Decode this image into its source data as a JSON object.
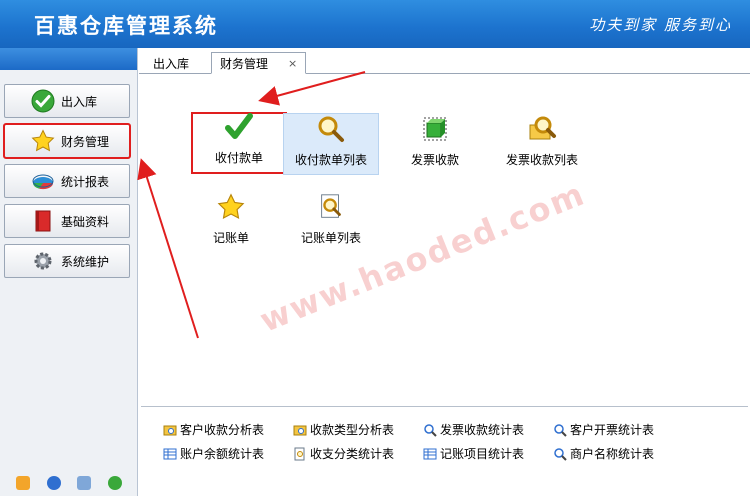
{
  "header": {
    "title": "百惠仓库管理系统",
    "slogan": "功夫到家 服务到心"
  },
  "sidebar": {
    "items": [
      {
        "label": "出入库",
        "icon": "check-circle-icon"
      },
      {
        "label": "财务管理",
        "icon": "star-icon"
      },
      {
        "label": "统计报表",
        "icon": "pie-chart-icon"
      },
      {
        "label": "基础资料",
        "icon": "book-icon"
      },
      {
        "label": "系统维护",
        "icon": "gear-icon"
      }
    ]
  },
  "tabs": [
    {
      "label": "出入库"
    },
    {
      "label": "财务管理",
      "close": "×"
    }
  ],
  "tiles": [
    {
      "label": "收付款单",
      "icon": "checkmark-icon"
    },
    {
      "label": "收付款单列表",
      "icon": "magnifier-icon"
    },
    {
      "label": "发票收款",
      "icon": "green-box-icon"
    },
    {
      "label": "发票收款列表",
      "icon": "magnifier-box-icon"
    },
    {
      "label": "记账单",
      "icon": "star-icon"
    },
    {
      "label": "记账单列表",
      "icon": "document-search-icon"
    }
  ],
  "watermark": "www.haoded.com",
  "reports": [
    {
      "label": "客户收款分析表",
      "icon": "folder-search-icon"
    },
    {
      "label": "收款类型分析表",
      "icon": "folder-search-icon"
    },
    {
      "label": "发票收款统计表",
      "icon": "magnifier-icon"
    },
    {
      "label": "客户开票统计表",
      "icon": "magnifier-icon"
    },
    {
      "label": "账户余额统计表",
      "icon": "table-icon"
    },
    {
      "label": "收支分类统计表",
      "icon": "magnifier-doc-icon"
    },
    {
      "label": "记账项目统计表",
      "icon": "table-icon"
    },
    {
      "label": "商户名称统计表",
      "icon": "magnifier-icon"
    }
  ],
  "colors": {
    "header": "#1d74cf",
    "highlight": "#e01e1e",
    "selected_tile": "#dbeafa"
  }
}
